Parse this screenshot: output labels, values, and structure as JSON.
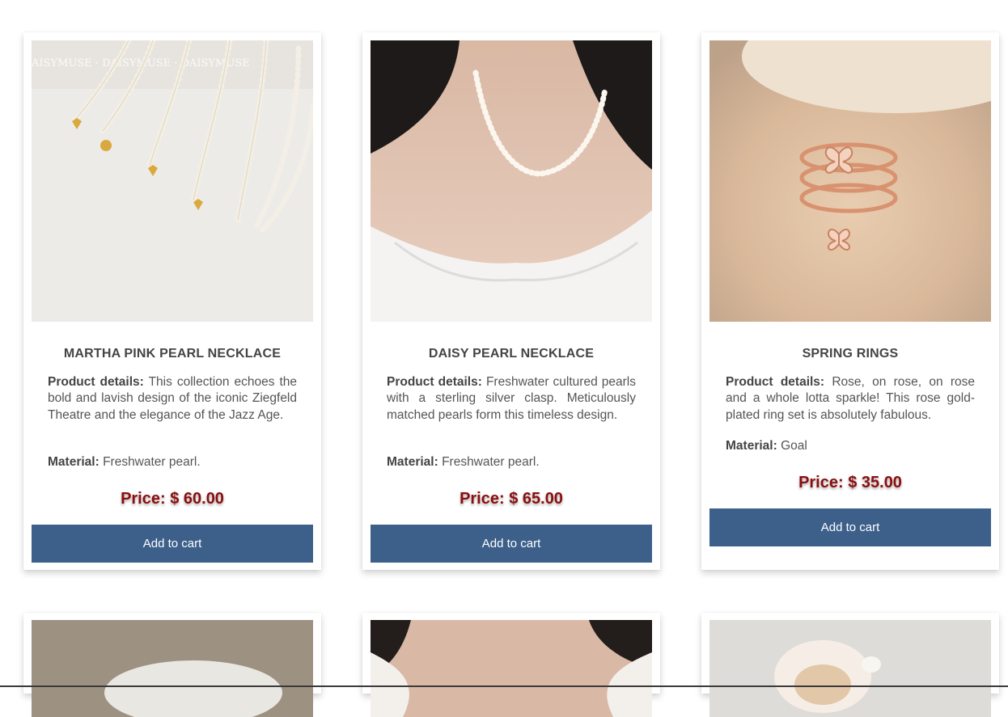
{
  "products": [
    {
      "name": "MARTHA PINK PEARL NECKLACE",
      "details_label": "Product details:",
      "details": "This collection echoes the bold and lavish design of the iconic Ziegfeld Theatre and the elegance of the Jazz Age.",
      "material_label": "Material:",
      "material": "Freshwater pearl.",
      "price": "Price: $ 60.00",
      "button": "Add to cart",
      "image_watermark": "DAISY MUSE"
    },
    {
      "name": "DAISY PEARL NECKLACE",
      "details_label": "Product details:",
      "details": "Freshwater cultured pearls with a sterling silver clasp. Meticulously matched pearls form this timeless design.",
      "material_label": "Material:",
      "material": "Freshwater pearl.",
      "price": "Price: $ 65.00",
      "button": "Add to cart"
    },
    {
      "name": "SPRING RINGS",
      "details_label": "Product details:",
      "details": "Rose, on rose, on rose and a whole lotta sparkle! This rose gold-plated ring set is absolutely fabulous.",
      "material_label": "Material:",
      "material": "Goal",
      "price": "Price: $ 35.00",
      "button": "Add to cart"
    }
  ],
  "colors": {
    "button_bg": "#3d608b",
    "price": "#8b0e0e",
    "text": "#444444"
  }
}
